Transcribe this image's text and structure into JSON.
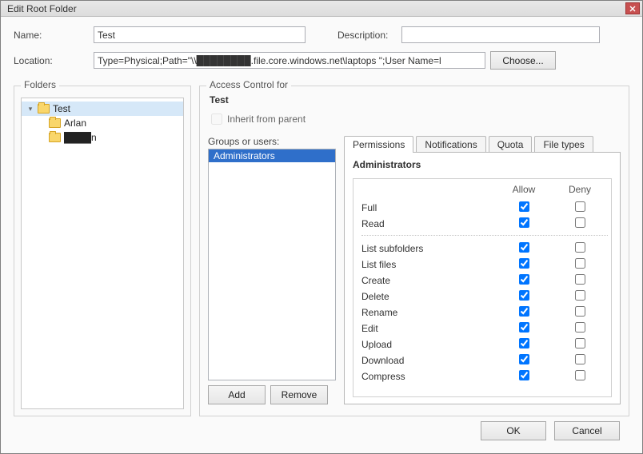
{
  "window": {
    "title": "Edit Root Folder"
  },
  "labels": {
    "name": "Name:",
    "description": "Description:",
    "location": "Location:",
    "choose": "Choose...",
    "folders": "Folders",
    "access_control_for": "Access Control for",
    "inherit": "Inherit from parent",
    "groups_or_users": "Groups or users:",
    "add": "Add",
    "remove": "Remove",
    "ok": "OK",
    "cancel": "Cancel",
    "allow": "Allow",
    "deny": "Deny"
  },
  "form": {
    "name_value": "Test",
    "description_value": "",
    "location_value": "Type=Physical;Path=\"\\\\████████.file.core.windows.net\\laptops \";User Name=l"
  },
  "tree": {
    "root": {
      "label": "Test",
      "expanded": true
    },
    "children": [
      {
        "label": "Arlan"
      },
      {
        "label": "████n"
      }
    ]
  },
  "access": {
    "target": "Test",
    "inherit_checked": false,
    "inherit_disabled": true
  },
  "groups": {
    "items": [
      "Administrators"
    ],
    "selected": "Administrators"
  },
  "tabs": {
    "items": [
      "Permissions",
      "Notifications",
      "Quota",
      "File types"
    ],
    "active": "Permissions"
  },
  "permissions": {
    "group_title": "Administrators",
    "top": [
      {
        "name": "Full",
        "allow": true,
        "deny": false
      },
      {
        "name": "Read",
        "allow": true,
        "deny": false
      }
    ],
    "rest": [
      {
        "name": "List subfolders",
        "allow": true,
        "deny": false
      },
      {
        "name": "List files",
        "allow": true,
        "deny": false
      },
      {
        "name": "Create",
        "allow": true,
        "deny": false
      },
      {
        "name": "Delete",
        "allow": true,
        "deny": false
      },
      {
        "name": "Rename",
        "allow": true,
        "deny": false
      },
      {
        "name": "Edit",
        "allow": true,
        "deny": false
      },
      {
        "name": "Upload",
        "allow": true,
        "deny": false
      },
      {
        "name": "Download",
        "allow": true,
        "deny": false
      },
      {
        "name": "Compress",
        "allow": true,
        "deny": false
      }
    ]
  }
}
